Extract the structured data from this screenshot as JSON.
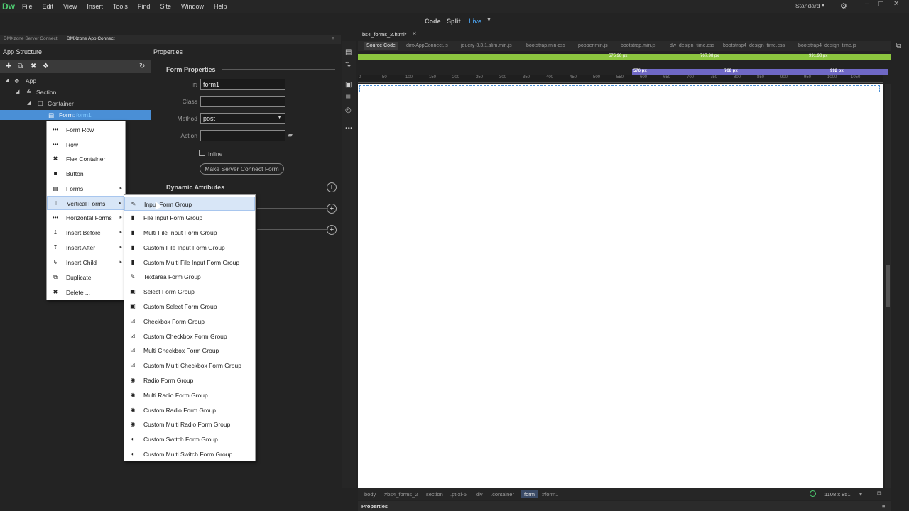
{
  "app": {
    "logo": "Dw",
    "menus": [
      "File",
      "Edit",
      "View",
      "Insert",
      "Tools",
      "Find",
      "Site",
      "Window",
      "Help"
    ],
    "workspace": "Standard",
    "view_buttons": {
      "code": "Code",
      "split": "Split",
      "live": "Live"
    }
  },
  "left_tabs": [
    "DMXzone Server Connect",
    "DMXzone App Connect"
  ],
  "app_structure": {
    "title": "App Structure",
    "tree": [
      {
        "label": "App",
        "level": 0
      },
      {
        "label": "Section",
        "level": 1
      },
      {
        "label": "Container",
        "level": 2
      },
      {
        "label": "Form:",
        "id": "form1",
        "level": 3,
        "selected": true
      }
    ]
  },
  "properties": {
    "title": "Properties",
    "form_section": "Form Properties",
    "id_label": "ID",
    "id_value": "form1",
    "class_label": "Class",
    "class_value": "",
    "method_label": "Method",
    "method_value": "post",
    "action_label": "Action",
    "action_value": "",
    "inline_label": "Inline",
    "server_connect_button": "Make Server Connect Form",
    "dynamic_section": "Dynamic Attributes"
  },
  "context_menu": [
    {
      "icon": "•••",
      "label": "Form Row"
    },
    {
      "icon": "•••",
      "label": "Row"
    },
    {
      "icon": "✖",
      "label": "Flex Container"
    },
    {
      "icon": "■",
      "label": "Button"
    },
    {
      "icon": "▤",
      "label": "Forms",
      "submenu": true
    },
    {
      "icon": "⁝",
      "label": "Vertical Forms",
      "submenu": true,
      "highlight": true
    },
    {
      "icon": "•••",
      "label": "Horizontal Forms",
      "submenu": true
    },
    {
      "icon": "↥",
      "label": "Insert Before",
      "submenu": true
    },
    {
      "icon": "↧",
      "label": "Insert After",
      "submenu": true
    },
    {
      "icon": "↳",
      "label": "Insert Child",
      "submenu": true
    },
    {
      "icon": "⧉",
      "label": "Duplicate"
    },
    {
      "icon": "✖",
      "label": "Delete ..."
    }
  ],
  "submenu": [
    {
      "icon": "✎",
      "label": "Input Form Group",
      "highlight": true
    },
    {
      "icon": "▮",
      "label": "File Input Form Group"
    },
    {
      "icon": "▮",
      "label": "Multi File Input Form Group"
    },
    {
      "icon": "▮",
      "label": "Custom File Input Form Group"
    },
    {
      "icon": "▮",
      "label": "Custom Multi File Input Form Group"
    },
    {
      "icon": "✎",
      "label": "Textarea Form Group"
    },
    {
      "icon": "▣",
      "label": "Select Form Group"
    },
    {
      "icon": "▣",
      "label": "Custom Select Form Group"
    },
    {
      "icon": "☑",
      "label": "Checkbox Form Group"
    },
    {
      "icon": "☑",
      "label": "Custom Checkbox Form Group"
    },
    {
      "icon": "☑",
      "label": "Multi Checkbox Form Group"
    },
    {
      "icon": "☑",
      "label": "Custom Multi Checkbox Form Group"
    },
    {
      "icon": "◉",
      "label": "Radio Form Group"
    },
    {
      "icon": "◉",
      "label": "Multi Radio Form Group"
    },
    {
      "icon": "◉",
      "label": "Custom Radio Form Group"
    },
    {
      "icon": "◉",
      "label": "Custom Multi Radio Form Group"
    },
    {
      "icon": "◐",
      "label": "Custom Switch Form Group"
    },
    {
      "icon": "◐",
      "label": "Custom Multi Switch Form Group"
    }
  ],
  "document": {
    "tab": "bs4_forms_2.html*",
    "source_tabs": [
      "Source Code",
      "dmxAppConnect.js",
      "jquery-3.3.1.slim.min.js",
      "bootstrap.min.css",
      "popper.min.js",
      "bootstrap.min.js",
      "dw_design_time.css",
      "bootstrap4_design_time.css",
      "bootstrap4_design_time.js"
    ],
    "green_labels": [
      "575.98 px",
      "767.98 px",
      "991.98 px"
    ],
    "purple_labels": [
      "576 px",
      "768 px",
      "992 px"
    ],
    "ruler_ticks": [
      "0",
      "50",
      "100",
      "150",
      "200",
      "250",
      "300",
      "350",
      "400",
      "450",
      "500",
      "550",
      "600",
      "650",
      "700",
      "750",
      "800",
      "850",
      "900",
      "950",
      "1000",
      "1050"
    ],
    "breadcrumbs": [
      "body",
      "#bs4_forms_2",
      "section",
      ".pt-xl-5",
      "div",
      ".container",
      "form",
      "#form1"
    ],
    "size": "1108 x 851",
    "bottom_panel": "Properties"
  }
}
